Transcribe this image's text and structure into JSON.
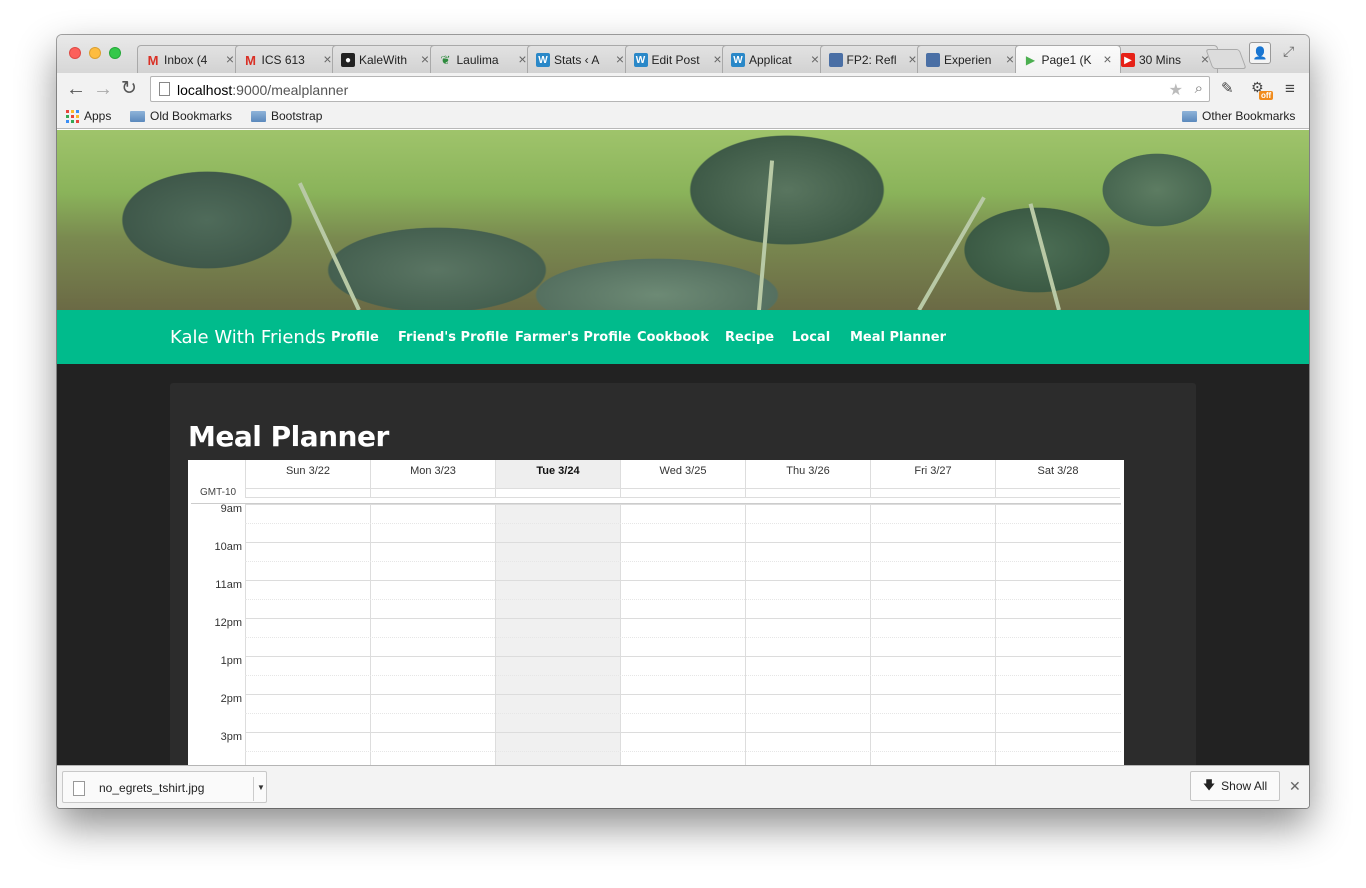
{
  "browser": {
    "tabs": [
      {
        "label": "Inbox (4",
        "icon": "gmail-icon",
        "color": "#d93025",
        "glyph": "M"
      },
      {
        "label": "ICS 613",
        "icon": "gmail-icon",
        "color": "#d93025",
        "glyph": "M"
      },
      {
        "label": "KaleWith",
        "icon": "github-icon",
        "color": "#222222",
        "glyph": "●"
      },
      {
        "label": "Laulima",
        "icon": "laulima-icon",
        "color": "#2e8b3e",
        "glyph": "❦"
      },
      {
        "label": "Stats ‹ A",
        "icon": "wordpress-icon",
        "color": "#2a88c8",
        "glyph": "W"
      },
      {
        "label": "Edit Post",
        "icon": "wordpress-icon",
        "color": "#2a88c8",
        "glyph": "W"
      },
      {
        "label": "Applicat",
        "icon": "wordpress-icon",
        "color": "#2a88c8",
        "glyph": "W"
      },
      {
        "label": "FP2: Refl",
        "icon": "page-icon",
        "color": "#4a6fa5",
        "glyph": ""
      },
      {
        "label": "Experien",
        "icon": "page-icon",
        "color": "#4a6fa5",
        "glyph": ""
      },
      {
        "label": "Page1 (K",
        "icon": "play-icon",
        "color": "#4caf50",
        "glyph": "▶",
        "active": true
      },
      {
        "label": "30 Mins",
        "icon": "youtube-icon",
        "color": "#e62117",
        "glyph": "▶"
      }
    ],
    "url_host": "localhost",
    "url_path": ":9000/mealplanner",
    "ext_badge": "off",
    "bookmarks": {
      "apps": "Apps",
      "items": [
        "Old Bookmarks",
        "Bootstrap"
      ],
      "other": "Other Bookmarks"
    }
  },
  "site": {
    "brand": "Kale With Friends",
    "nav": [
      "Profile",
      "Friend's Profile",
      "Farmer's Profile",
      "Cookbook",
      "Recipe",
      "Local",
      "Meal Planner"
    ],
    "accent": "#00bb8c",
    "page_title": "Meal Planner"
  },
  "calendar": {
    "timezone": "GMT-10",
    "days": [
      "Sun 3/22",
      "Mon 3/23",
      "Tue 3/24",
      "Wed 3/25",
      "Thu 3/26",
      "Fri 3/27",
      "Sat 3/28"
    ],
    "today": "Tue 3/24",
    "hours": [
      "9am",
      "10am",
      "11am",
      "12pm",
      "1pm",
      "2pm",
      "3pm"
    ]
  },
  "downloads": {
    "file_name": "no_egrets_tshirt.jpg",
    "show_all": "Show All"
  }
}
